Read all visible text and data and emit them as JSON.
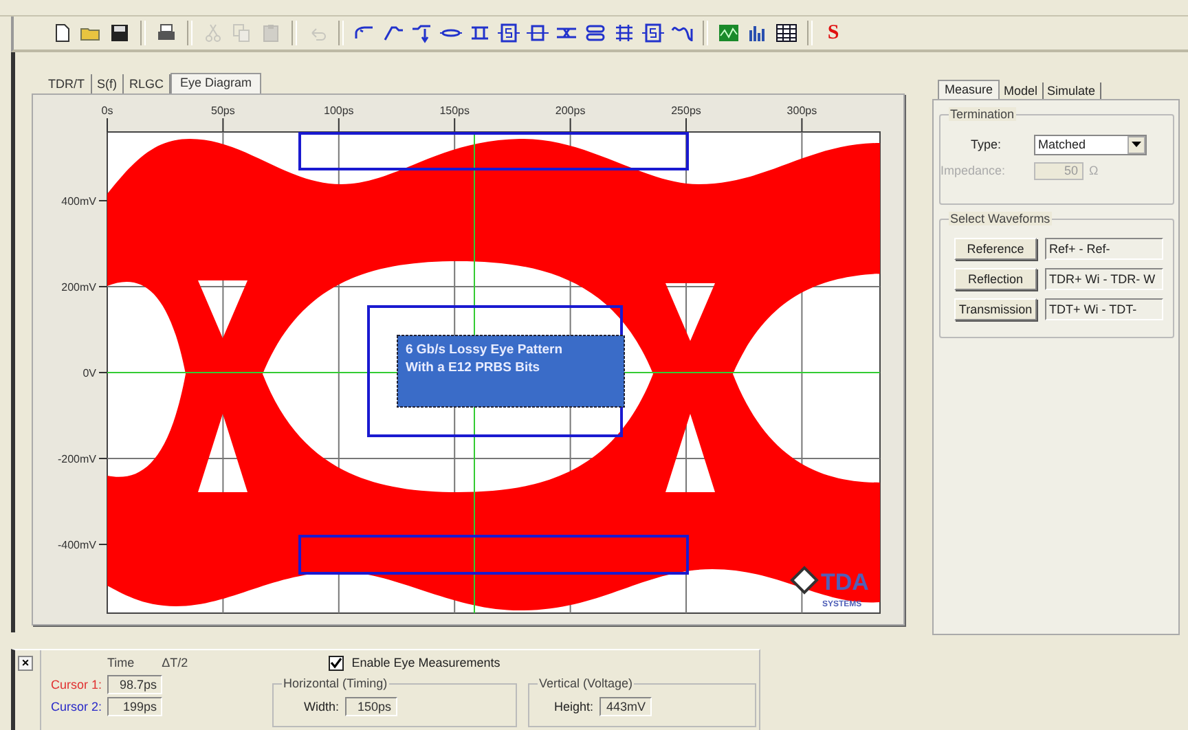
{
  "toolbar": [
    [
      {
        "kind": "new",
        "disabled": false
      },
      {
        "kind": "open",
        "disabled": false
      },
      {
        "kind": "save",
        "disabled": false
      }
    ],
    [
      {
        "kind": "print",
        "disabled": false
      }
    ],
    [
      {
        "kind": "cut",
        "disabled": true
      },
      {
        "kind": "copy",
        "disabled": true
      },
      {
        "kind": "paste",
        "disabled": true
      }
    ],
    [
      {
        "kind": "undo",
        "disabled": true
      }
    ],
    [
      {
        "kind": "step",
        "disabled": false
      },
      {
        "kind": "ramp",
        "disabled": false
      },
      {
        "kind": "tee",
        "disabled": false
      },
      {
        "kind": "wire",
        "disabled": false
      },
      {
        "kind": "line",
        "disabled": false
      },
      {
        "kind": "sparam",
        "disabled": false
      },
      {
        "kind": "block",
        "disabled": false
      },
      {
        "kind": "coupled",
        "disabled": false
      },
      {
        "kind": "pair",
        "disabled": false
      },
      {
        "kind": "mesh",
        "disabled": false
      },
      {
        "kind": "sparam",
        "disabled": false
      },
      {
        "kind": "pulse",
        "disabled": false
      }
    ],
    [
      {
        "kind": "chart",
        "disabled": false
      },
      {
        "kind": "bars",
        "disabled": false
      },
      {
        "kind": "grid",
        "disabled": false
      }
    ],
    [
      {
        "kind": "letter",
        "label": "S",
        "disabled": false
      }
    ]
  ],
  "main_tabs": [
    {
      "label": "TDR/T",
      "selected": false
    },
    {
      "label": "S(f)",
      "selected": false
    },
    {
      "label": "RLGC",
      "selected": false
    },
    {
      "label": "Eye Diagram",
      "selected": true
    }
  ],
  "plot": {
    "x_ticks": [
      "0s",
      "50ps",
      "100ps",
      "150ps",
      "200ps",
      "250ps",
      "300ps"
    ],
    "y_ticks": [
      "400mV",
      "200mV",
      "0V",
      "-200mV",
      "-400mV"
    ],
    "annotation": [
      "6 Gb/s Lossy Eye Pattern",
      "With a E12 PRBS Bits"
    ],
    "logo": {
      "name": "TDA",
      "tagline": "SYSTEMS"
    }
  },
  "side_panel": {
    "tabs": [
      {
        "label": "Measure",
        "selected": true
      },
      {
        "label": "Model",
        "selected": false
      },
      {
        "label": "Simulate",
        "selected": false
      }
    ],
    "termination": {
      "title": "Termination",
      "type_label": "Type:",
      "type_value": "Matched",
      "impedance_label": "Impedance:",
      "impedance_value": "50",
      "impedance_unit": "Ω",
      "impedance_disabled": true
    },
    "waveforms": {
      "title": "Select Waveforms",
      "rows": [
        {
          "button": "Reference",
          "value": "Ref+ - Ref-"
        },
        {
          "button": "Reflection",
          "value": "TDR+ Wi - TDR- W"
        },
        {
          "button": "Transmission",
          "value": "TDT+ Wi - TDT-"
        }
      ]
    }
  },
  "measurements": {
    "close": "×",
    "time_header": "Time",
    "delta_header": "ΔT/2",
    "enable": {
      "label": "Enable Eye Measurements",
      "checked": true
    },
    "cursors": [
      {
        "label": "Cursor 1:",
        "value": "98.7ps",
        "color": "#e03030"
      },
      {
        "label": "Cursor 2:",
        "value": "199ps",
        "color": "#2828c8"
      }
    ],
    "groups": [
      {
        "title": "Horizontal (Timing)",
        "label": "Width:",
        "value": "150ps"
      },
      {
        "title": "Vertical (Voltage)",
        "label": "Height:",
        "value": "443mV"
      }
    ]
  }
}
